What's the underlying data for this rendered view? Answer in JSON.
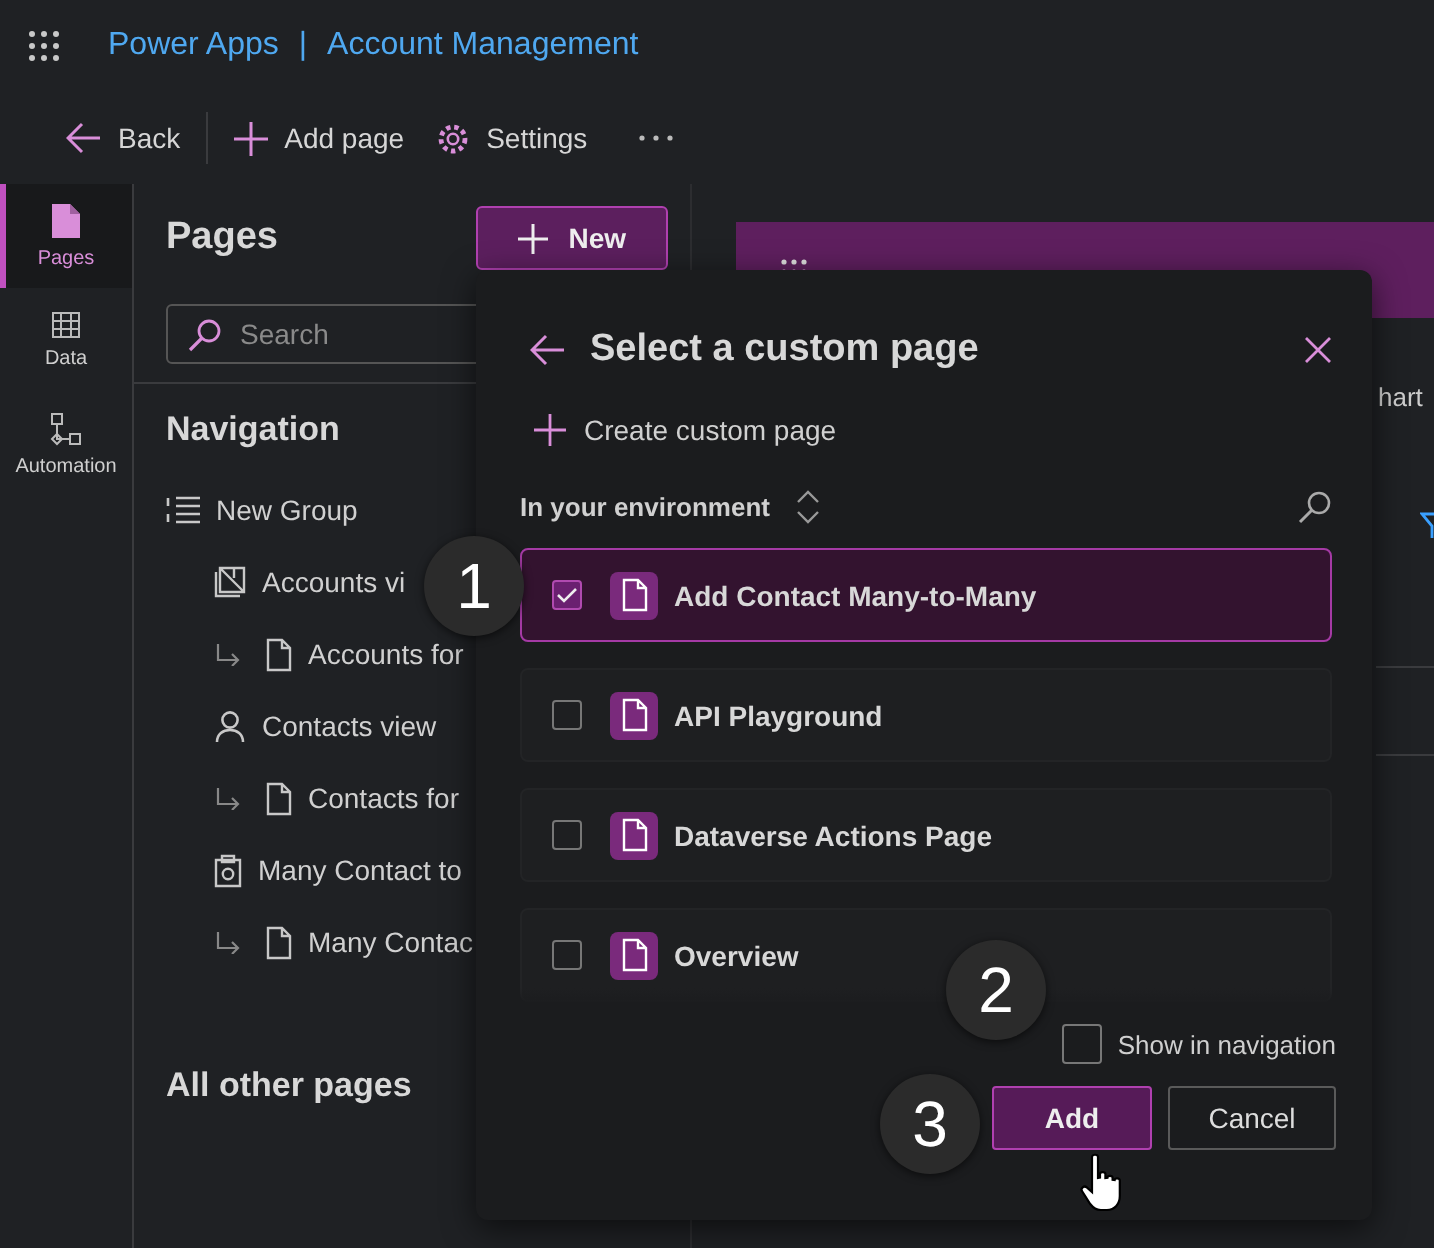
{
  "app_bar": {
    "product": "Power Apps",
    "separator": "|",
    "app": "Account Management"
  },
  "toolbar": [
    {
      "kind": "back",
      "label": "Back"
    },
    {
      "kind": "add",
      "label": "Add page"
    },
    {
      "kind": "settings",
      "label": "Settings"
    },
    {
      "kind": "more"
    }
  ],
  "rail": [
    {
      "kind": "pages",
      "label": "Pages",
      "selected": true
    },
    {
      "kind": "data",
      "label": "Data",
      "selected": false
    },
    {
      "kind": "automation",
      "label": "Automation",
      "selected": false
    }
  ],
  "pages_panel": {
    "title": "Pages",
    "new_button": "New",
    "search": {
      "placeholder": "Search"
    },
    "navigation_heading": "Navigation",
    "tree": [
      {
        "kind": "group",
        "label": "New Group",
        "children": [
          {
            "kind": "table",
            "label": "Accounts vi",
            "children": [
              {
                "kind": "form",
                "label": "Accounts for"
              }
            ]
          },
          {
            "kind": "person",
            "label": "Contacts view",
            "children": [
              {
                "kind": "form",
                "label": "Contacts for"
              }
            ]
          },
          {
            "kind": "custom",
            "label": "Many Contact to",
            "children": [
              {
                "kind": "form",
                "label": "Many Contac"
              }
            ]
          }
        ]
      }
    ],
    "other_heading": "All other pages"
  },
  "preview": {
    "partial_label": "hart"
  },
  "dialog": {
    "title": "Select a custom page",
    "create_link": "Create custom page",
    "filter_label": "In your environment",
    "items": [
      {
        "label": "Add Contact Many-to-Many",
        "checked": true,
        "selected": true
      },
      {
        "label": "API Playground",
        "checked": false,
        "selected": false
      },
      {
        "label": "Dataverse Actions Page",
        "checked": false,
        "selected": false
      },
      {
        "label": "Overview",
        "checked": false,
        "selected": false
      }
    ],
    "show_in_navigation": {
      "label": "Show in navigation",
      "checked": false
    },
    "add_button": "Add",
    "cancel_button": "Cancel"
  },
  "steps": [
    "1",
    "2",
    "3"
  ]
}
